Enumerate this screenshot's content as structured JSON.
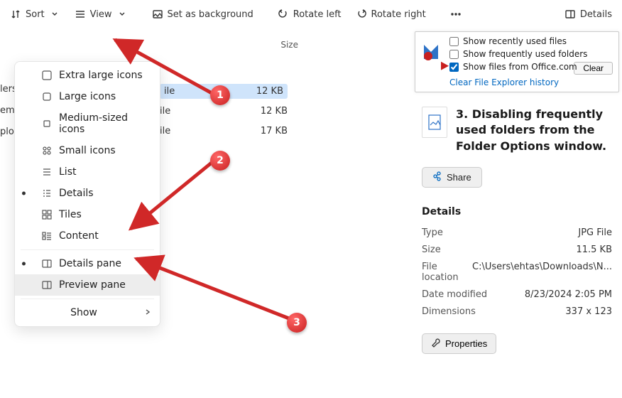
{
  "toolbar": {
    "sort": "Sort",
    "view": "View",
    "set_bg": "Set as background",
    "rotate_left": "Rotate left",
    "rotate_right": "Rotate right",
    "details": "Details"
  },
  "columns": {
    "size": "Size"
  },
  "sidebar_fragments": [
    "lers",
    "ems",
    "plo"
  ],
  "rows": [
    {
      "type": "ile",
      "size": "12 KB"
    },
    {
      "type": "ile",
      "size": "12 KB"
    },
    {
      "type": "ile",
      "size": "17 KB"
    }
  ],
  "row_highlight_index": 0,
  "menu": {
    "items": [
      {
        "label": "Extra large icons",
        "icon": "square"
      },
      {
        "label": "Large icons",
        "icon": "square"
      },
      {
        "label": "Medium-sized icons",
        "icon": "square"
      },
      {
        "label": "Small icons",
        "icon": "grid4"
      },
      {
        "label": "List",
        "icon": "list"
      },
      {
        "label": "Details",
        "icon": "list",
        "checked": true
      },
      {
        "label": "Tiles",
        "icon": "tiles"
      },
      {
        "label": "Content",
        "icon": "content"
      }
    ],
    "panes": [
      {
        "label": "Details pane",
        "icon": "pane",
        "checked": true
      },
      {
        "label": "Preview pane",
        "icon": "pane",
        "selected": true
      }
    ],
    "show": "Show"
  },
  "annotations": {
    "badges": [
      "1",
      "2",
      "3"
    ]
  },
  "privacy": {
    "row1": "Show recently used files",
    "row2": "Show frequently used folders",
    "row3": "Show files from Office.com",
    "clear_link": "Clear File Explorer history",
    "clear_btn": "Clear"
  },
  "preview": {
    "title": "3. Disabling frequently used folders from the Folder Options window.",
    "share": "Share",
    "section": "Details",
    "rows": {
      "Type": "JPG File",
      "Size": "11.5 KB",
      "File location": "C:\\Users\\ehtas\\Downloads\\N...",
      "Date modified": "8/23/2024 2:05 PM",
      "Dimensions": "337 x 123"
    },
    "properties": "Properties"
  }
}
